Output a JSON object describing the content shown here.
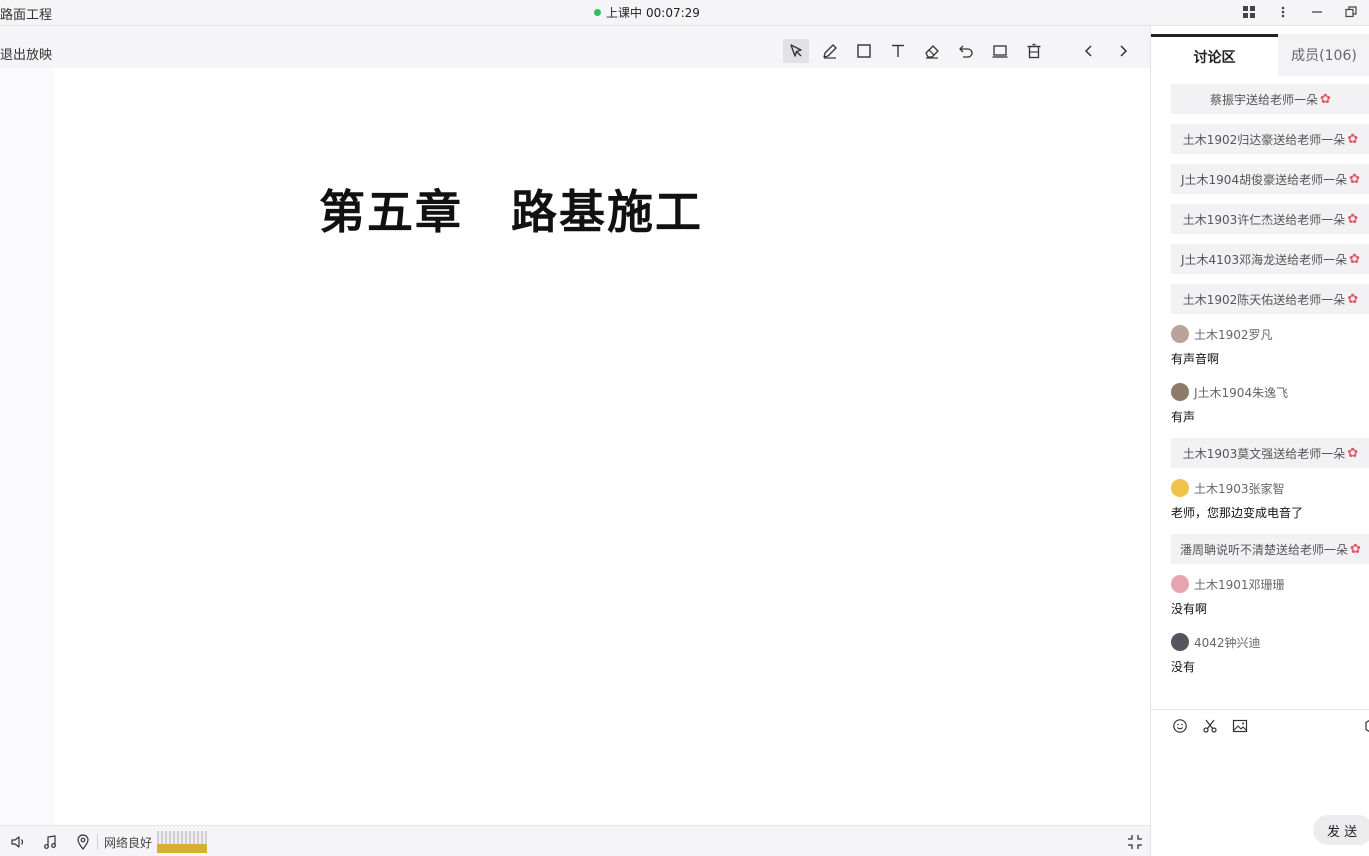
{
  "window": {
    "title": "路面工程",
    "status_label": "上课中",
    "timer": "00:07:29"
  },
  "toolbar": {
    "exit_label": "退出放映",
    "tools": [
      "pointer-icon",
      "pen-icon",
      "rectangle-icon",
      "text-icon",
      "eraser-icon",
      "undo-icon",
      "whiteboard-icon",
      "delete-icon"
    ],
    "nav": [
      "previous-page-icon",
      "next-page-icon"
    ]
  },
  "slide": {
    "title": "第五章　路基施工"
  },
  "bottombar": {
    "icons": [
      "speaker-icon",
      "music-icon",
      "location-icon"
    ],
    "network_label": "网络良好",
    "colors": {
      "network_meter": "#d5b02e"
    }
  },
  "panel": {
    "tab_discussion": "讨论区",
    "tab_members": "成员(106)",
    "send_label": "发 送",
    "messages": [
      {
        "type": "gift",
        "text": "蔡振宇送给老师一朵"
      },
      {
        "type": "gift",
        "text": "土木1902归达豪送给老师一朵"
      },
      {
        "type": "gift",
        "text": "J土木1904胡俊豪送给老师一朵"
      },
      {
        "type": "gift",
        "text": "土木1903许仁杰送给老师一朵"
      },
      {
        "type": "gift",
        "text": "J土木4103邓海龙送给老师一朵"
      },
      {
        "type": "gift",
        "text": "土木1902陈天佑送给老师一朵"
      },
      {
        "type": "chat",
        "name": "土木1902罗凡",
        "text": "有声音啊"
      },
      {
        "type": "chat",
        "name": "J土木1904朱逸飞",
        "text": "有声"
      },
      {
        "type": "gift",
        "text": "土木1903莫文强送给老师一朵"
      },
      {
        "type": "chat",
        "name": "土木1903张家智",
        "text": "老师，您那边变成电音了"
      },
      {
        "type": "gift",
        "text": "潘周聃说听不清楚送给老师一朵"
      },
      {
        "type": "chat",
        "name": "土木1901邓珊珊",
        "text": "没有啊"
      },
      {
        "type": "chat",
        "name": "4042钟兴迪",
        "text": "没有"
      }
    ],
    "input_icons": [
      "emoji-icon",
      "scissors-icon",
      "image-icon"
    ],
    "colors": {
      "flower": "#e05a66",
      "live_dot": "#2dbe60"
    }
  }
}
